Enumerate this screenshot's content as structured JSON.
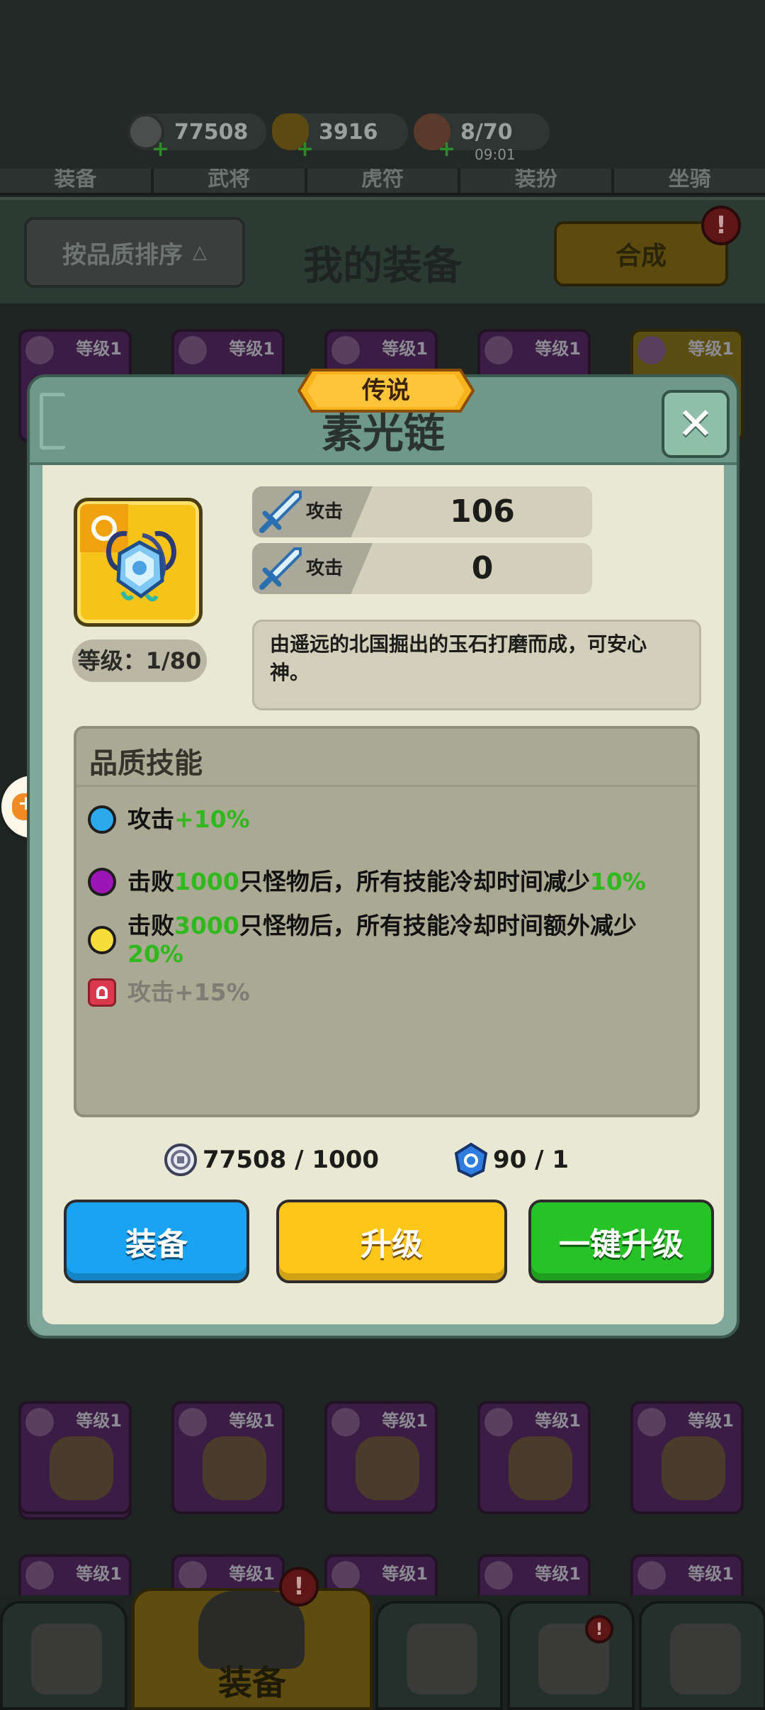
{
  "resources": [
    {
      "icon": "silver-coin-icon",
      "value": "77508"
    },
    {
      "icon": "gold-ingot-icon",
      "value": "3916"
    },
    {
      "icon": "meat-stamina-icon",
      "value": "8/70",
      "timer": "09:01"
    }
  ],
  "category_tabs": [
    "装备",
    "武将",
    "虎符",
    "装扮",
    "坐骑"
  ],
  "list_header": {
    "sort_label": "按品质排序",
    "title": "我的装备",
    "merge_label": "合成",
    "badge": "!"
  },
  "grid_level_label": "等级1",
  "bottom_nav": {
    "active_label": "装备"
  },
  "modal": {
    "rarity": "传说",
    "title": "素光链",
    "level_text": "等级：1/80",
    "stats": [
      {
        "label": "攻击",
        "value": "106"
      },
      {
        "label": "攻击",
        "value": "0"
      }
    ],
    "description": "由遥远的北国掘出的玉石打磨而成，可安心神。",
    "skills_title": "品质技能",
    "skills": [
      {
        "color": "#2aa9ec",
        "pre": "攻击",
        "hl1": "+10%",
        "mid": "",
        "hl2": "",
        "post": ""
      },
      {
        "color": "#9b16b5",
        "pre": "击败",
        "hl1": "1000",
        "mid": "只怪物后，所有技能冷却时间减少",
        "hl2": "10%",
        "post": ""
      },
      {
        "color": "#f7dc3a",
        "pre": "击败",
        "hl1": "3000",
        "mid": "只怪物后，所有技能冷却时间额外减少",
        "hl2": "20%",
        "post": ""
      },
      {
        "locked": true,
        "text": "攻击+15%"
      }
    ],
    "cost_coin": "77508 / 1000",
    "cost_gem": "90 / 1",
    "buttons": {
      "equip": "装备",
      "upgrade": "升级",
      "upgrade_all": "一键升级"
    }
  },
  "colors": {
    "modal_header": "#6e998a",
    "modal_body": "#e9e8d2",
    "equip_button": "#1aa3f2",
    "upgrade_button": "#ffc61a",
    "upgrade_all_button": "#27c227",
    "highlight_text": "#32b81f"
  }
}
